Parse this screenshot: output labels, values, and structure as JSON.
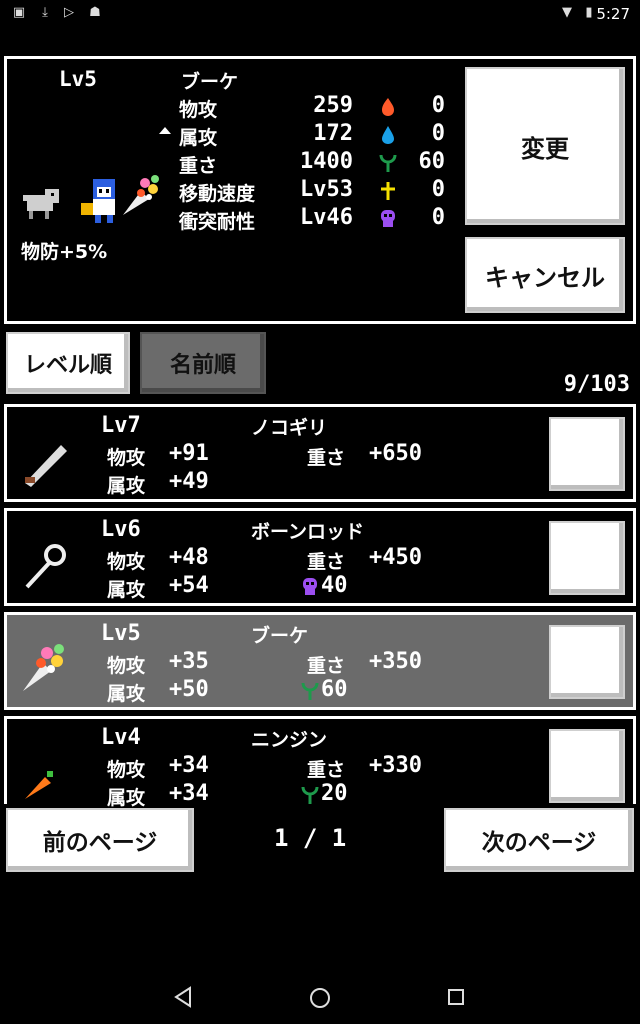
{
  "status_bar": {
    "time": "5:27"
  },
  "detail": {
    "level": "Lv5",
    "name": "ブーケ",
    "stats": [
      {
        "label": "物攻",
        "value": "259",
        "elem_value": "0"
      },
      {
        "label": "属攻",
        "value": "172",
        "elem_value": "0"
      },
      {
        "label": "重さ",
        "value": "1400",
        "elem_value": "60"
      },
      {
        "label": "移動速度",
        "value": "Lv53",
        "elem_value": "0"
      },
      {
        "label": "衝突耐性",
        "value": "Lv46",
        "elem_value": "0"
      }
    ],
    "bonus": "物防+5%",
    "change_button": "変更",
    "cancel_button": "キャンセル",
    "colors": {
      "fire": "#ff5a2a",
      "water": "#1aa0e8",
      "plant": "#1e9a4c",
      "holy": "#f5e000",
      "dark": "#9b4ef0"
    }
  },
  "sort": {
    "level_sort": "レベル順",
    "name_sort": "名前順",
    "count": "9/103"
  },
  "items": [
    {
      "level": "Lv7",
      "name": "ノコギリ",
      "atk_label": "物攻",
      "atk": "+91",
      "elem_label": "属攻",
      "elem": "+49",
      "weight_label": "重さ",
      "weight": "+650",
      "extra": "",
      "extra_icon": "",
      "selected": false
    },
    {
      "level": "Lv6",
      "name": "ボーンロッド",
      "atk_label": "物攻",
      "atk": "+48",
      "elem_label": "属攻",
      "elem": "+54",
      "weight_label": "重さ",
      "weight": "+450",
      "extra": "40",
      "extra_icon": "skull-icon",
      "selected": false
    },
    {
      "level": "Lv5",
      "name": "ブーケ",
      "atk_label": "物攻",
      "atk": "+35",
      "elem_label": "属攻",
      "elem": "+50",
      "weight_label": "重さ",
      "weight": "+350",
      "extra": "60",
      "extra_icon": "plant-icon",
      "selected": true
    },
    {
      "level": "Lv4",
      "name": "ニンジン",
      "atk_label": "物攻",
      "atk": "+34",
      "elem_label": "属攻",
      "elem": "+34",
      "weight_label": "重さ",
      "weight": "+330",
      "extra": "20",
      "extra_icon": "plant-icon",
      "selected": false
    }
  ],
  "pager": {
    "prev": "前のページ",
    "next": "次のページ",
    "page": "1 / 1"
  }
}
